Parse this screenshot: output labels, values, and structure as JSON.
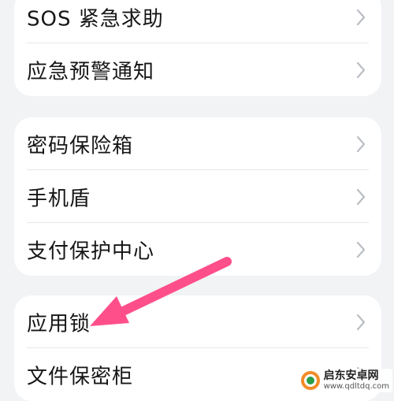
{
  "groups": [
    {
      "items": [
        {
          "label": "SOS 紧急求助"
        },
        {
          "label": "应急预警通知"
        }
      ]
    },
    {
      "items": [
        {
          "label": "密码保险箱"
        },
        {
          "label": "手机盾"
        },
        {
          "label": "支付保护中心"
        }
      ]
    },
    {
      "items": [
        {
          "label": "应用锁"
        },
        {
          "label": "文件保密柜"
        }
      ]
    }
  ],
  "annotation": {
    "arrow_color": "#ff4f8a",
    "points_to": "应用锁"
  },
  "watermark": {
    "title": "启东安卓网",
    "url": "www.qdltdq.com"
  },
  "colors": {
    "background": "#f1f3f5",
    "card": "#ffffff",
    "chevron": "#b9bec4"
  }
}
